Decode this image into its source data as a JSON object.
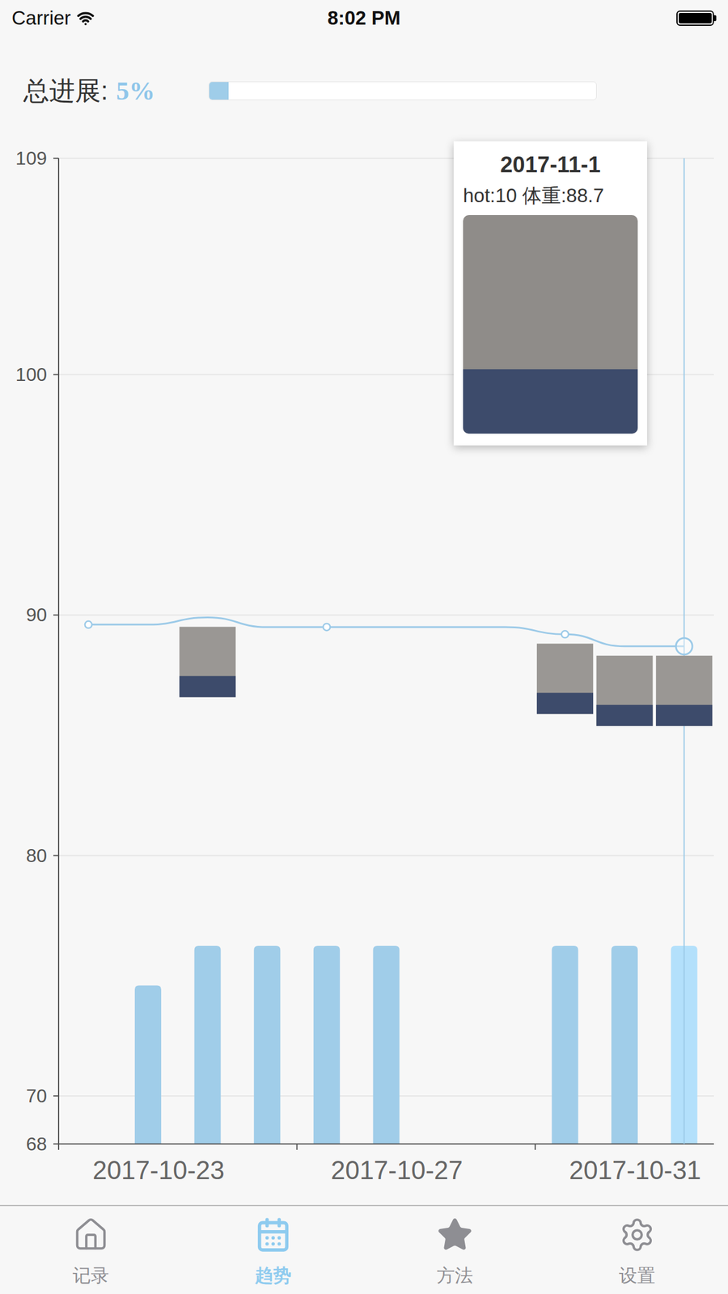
{
  "status_bar": {
    "carrier": "Carrier",
    "time": "8:02 PM",
    "battery_level": 1
  },
  "progress": {
    "label": "总进展:",
    "value": "5%",
    "level": 0.05
  },
  "chart": {
    "y_ticks": [
      "109",
      "100",
      "90",
      "80",
      "70",
      "68"
    ],
    "x_labels": [
      "2017-10-23",
      "2017-10-27",
      "2017-10-31"
    ],
    "weight": [
      89.6,
      89.6,
      89.9,
      89.5,
      89.5,
      89.5,
      89.5,
      89.5,
      89.2,
      88.7,
      88.7
    ],
    "hot": [
      0,
      8,
      10,
      10,
      10,
      10,
      0,
      0,
      10,
      10,
      10
    ],
    "markers": [
      true,
      false,
      false,
      false,
      true,
      false,
      false,
      false,
      true,
      false,
      true
    ],
    "photos": [
      false,
      false,
      true,
      false,
      false,
      false,
      false,
      false,
      true,
      true,
      true
    ],
    "selected": [
      false,
      false,
      false,
      false,
      false,
      false,
      false,
      false,
      false,
      false,
      true
    ]
  },
  "tooltip": {
    "title": "2017-11-1",
    "text": "hot:10 体重:88.7",
    "photo": true
  },
  "tabs": [
    {
      "label": "记录",
      "selected": false
    },
    {
      "label": "趋势",
      "selected": true
    },
    {
      "label": "方法",
      "selected": false
    },
    {
      "label": "设置",
      "selected": false
    }
  ]
}
